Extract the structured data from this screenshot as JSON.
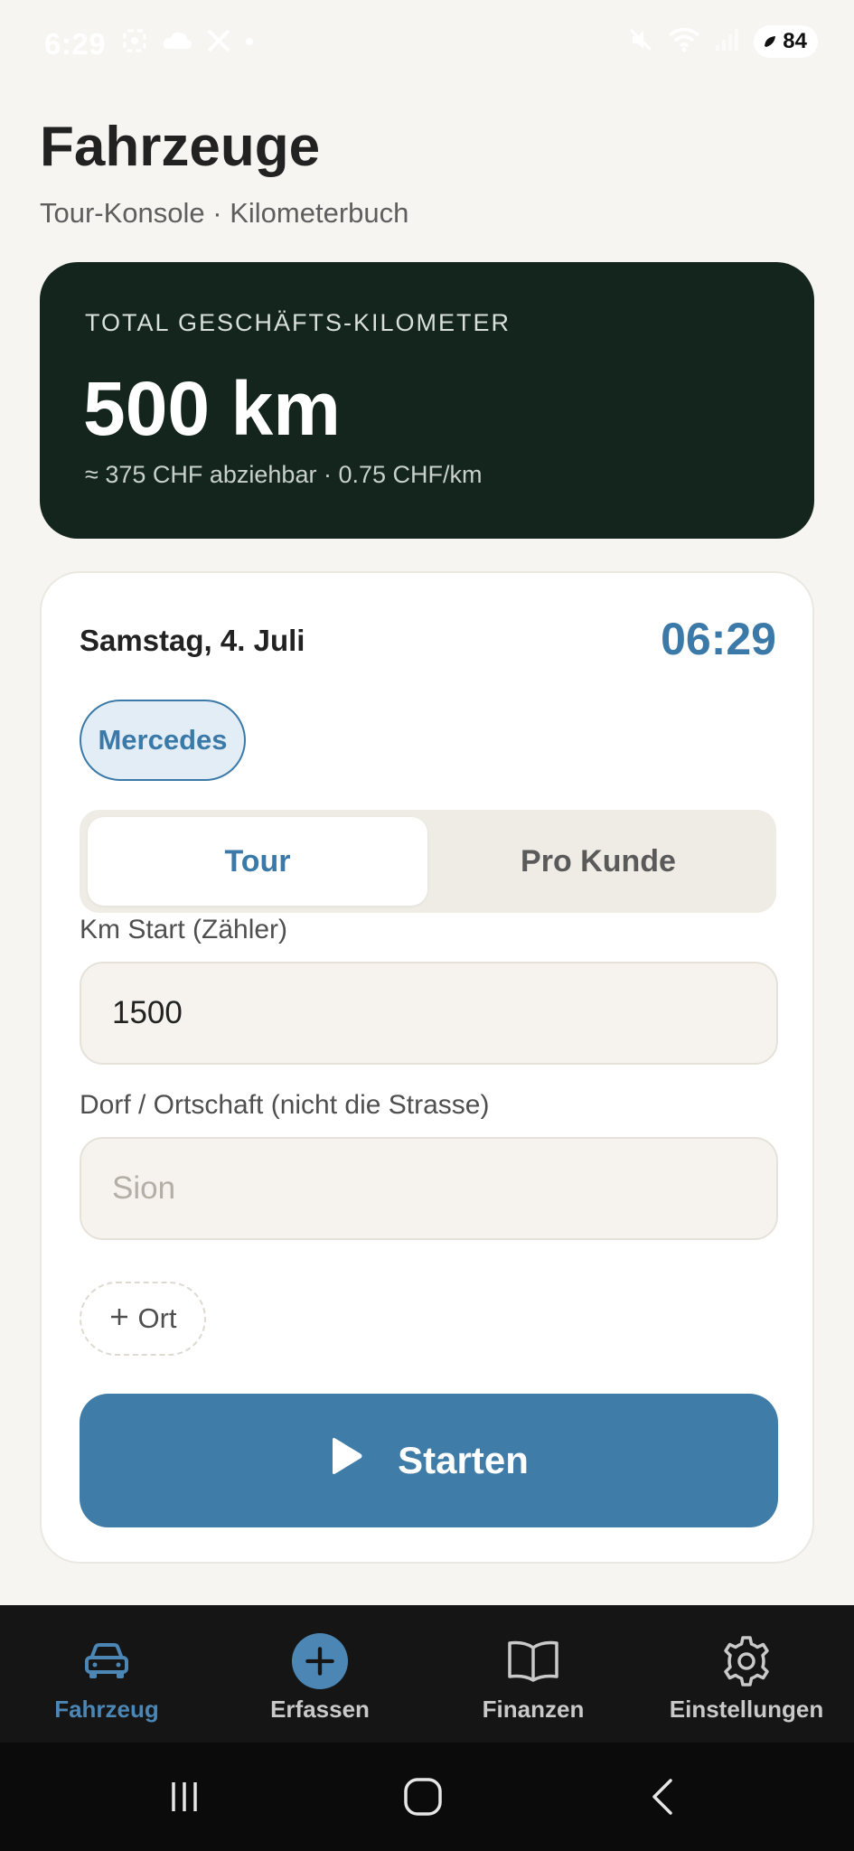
{
  "status_bar": {
    "time": "6:29",
    "battery_level": "84",
    "icons_left": [
      "screenshot-icon",
      "cloud-icon",
      "x-logo-icon",
      "dot-icon"
    ],
    "icons_right": [
      "mute-icon",
      "wifi-icon",
      "signal-icon",
      "battery-icon"
    ]
  },
  "header": {
    "title": "Fahrzeuge",
    "subtitle": "Tour-Konsole · Kilometerbuch"
  },
  "total_card": {
    "label": "TOTAL GESCHÄFTS-KILOMETER",
    "value": "500 km",
    "note": "≈ 375 CHF abziehbar · 0.75 CHF/km"
  },
  "trip_form": {
    "date": "Samstag, 4. Juli",
    "clock": "06:29",
    "vehicle_chip": "Mercedes",
    "mode_tabs": [
      {
        "label": "Tour",
        "active": true
      },
      {
        "label": "Pro Kunde",
        "active": false
      }
    ],
    "km_start": {
      "label": "Km Start (Zähler)",
      "value": "1500"
    },
    "place": {
      "label": "Dorf / Ortschaft (nicht die Strasse)",
      "placeholder": "Sion",
      "value": ""
    },
    "add_place_label": "Ort",
    "start_button_label": "Starten"
  },
  "bottom_nav": {
    "items": [
      {
        "label": "Fahrzeug",
        "icon": "car-icon",
        "active": true
      },
      {
        "label": "Erfassen",
        "icon": "plus-circle-icon",
        "active": false
      },
      {
        "label": "Finanzen",
        "icon": "book-icon",
        "active": false
      },
      {
        "label": "Einstellungen",
        "icon": "gear-icon",
        "active": false
      }
    ]
  },
  "colors": {
    "accent": "#3f7ca8",
    "dark_card": "#13251c",
    "background": "#f7f5f1",
    "nav_background": "#151515"
  }
}
